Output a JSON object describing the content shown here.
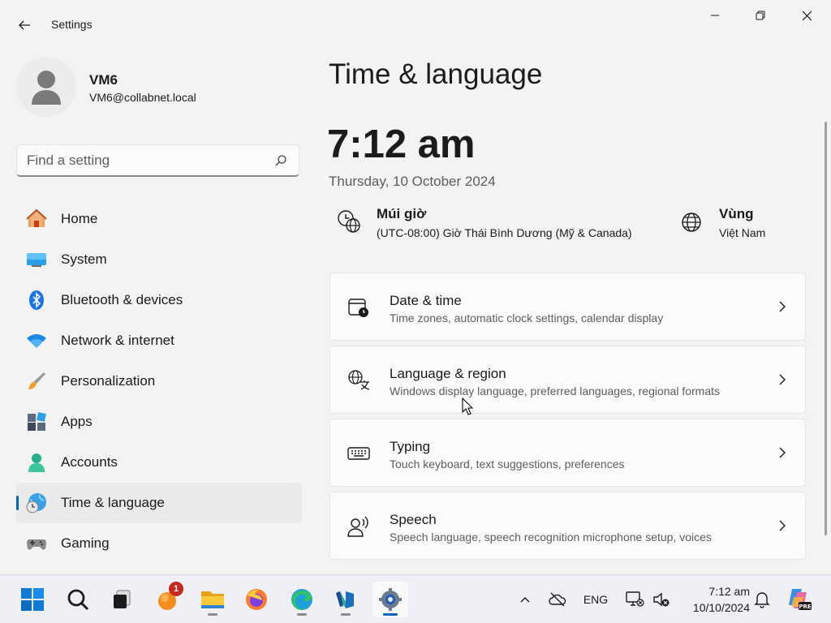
{
  "window": {
    "title": "Settings"
  },
  "profile": {
    "name": "VM6",
    "email": "VM6@collabnet.local"
  },
  "search": {
    "placeholder": "Find a setting"
  },
  "nav": {
    "items": [
      {
        "label": "Home",
        "icon": "home-icon"
      },
      {
        "label": "System",
        "icon": "system-icon"
      },
      {
        "label": "Bluetooth & devices",
        "icon": "bluetooth-icon"
      },
      {
        "label": "Network & internet",
        "icon": "wifi-icon"
      },
      {
        "label": "Personalization",
        "icon": "brush-icon"
      },
      {
        "label": "Apps",
        "icon": "apps-icon"
      },
      {
        "label": "Accounts",
        "icon": "accounts-icon"
      },
      {
        "label": "Time & language",
        "icon": "time-language-icon",
        "active": true
      },
      {
        "label": "Gaming",
        "icon": "gaming-icon"
      }
    ]
  },
  "main": {
    "title": "Time & language",
    "time": "7:12 am",
    "date": "Thursday, 10 October 2024",
    "timezone": {
      "label": "Múi giờ",
      "value": "(UTC-08:00) Giờ Thái Bình Dương (Mỹ & Canada)"
    },
    "region": {
      "label": "Vùng",
      "value": "Việt Nam"
    },
    "cards": [
      {
        "title": "Date & time",
        "desc": "Time zones, automatic clock settings, calendar display",
        "icon": "calendar-clock-icon"
      },
      {
        "title": "Language & region",
        "desc": "Windows display language, preferred languages, regional formats",
        "icon": "language-icon"
      },
      {
        "title": "Typing",
        "desc": "Touch keyboard, text suggestions, preferences",
        "icon": "keyboard-icon"
      },
      {
        "title": "Speech",
        "desc": "Speech language, speech recognition microphone setup, voices",
        "icon": "speech-icon"
      }
    ]
  },
  "taskbar": {
    "mail_badge": "1",
    "language": "ENG",
    "clock_time": "7:12 am",
    "clock_date": "10/10/2024"
  },
  "colors": {
    "accent": "#0067c0",
    "background": "#f3f3f3",
    "card": "#fbfbfb"
  }
}
